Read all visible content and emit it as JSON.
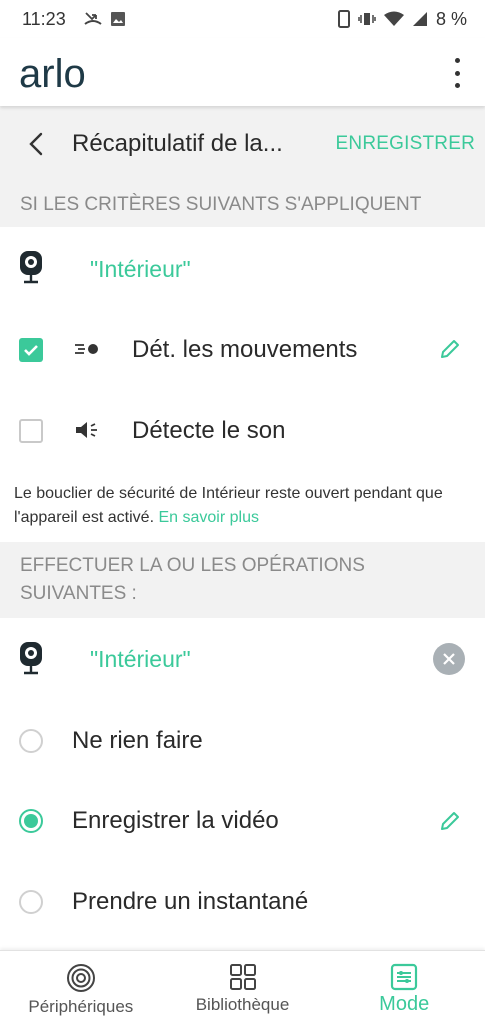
{
  "status_bar": {
    "time": "11:23",
    "battery": "8 %"
  },
  "app": {
    "logo": "arlo"
  },
  "title_bar": {
    "title": "Récapitulatif de la...",
    "save_label": "ENREGISTRER"
  },
  "trigger_section": {
    "header": "SI LES CRITÈRES SUIVANTS S'APPLIQUENT",
    "device_name": "\"Intérieur\"",
    "options": [
      {
        "label": "Dét. les mouvements",
        "checked": true
      },
      {
        "label": "Détecte le son",
        "checked": false
      }
    ],
    "info_text": "Le bouclier de sécurité de Intérieur reste ouvert pendant que l'appareil est activé.",
    "info_link": "En savoir plus"
  },
  "action_section": {
    "header_line1": "EFFECTUER LA OU LES OPÉRATIONS",
    "header_line2": "SUIVANTES :",
    "device_name": "\"Intérieur\"",
    "options": [
      {
        "label": "Ne rien faire",
        "selected": false
      },
      {
        "label": "Enregistrer la vidéo",
        "selected": true
      },
      {
        "label": "Prendre un instantané",
        "selected": false
      }
    ]
  },
  "bottom_nav": {
    "items": [
      {
        "label": "Périphériques",
        "icon": "devices-icon",
        "active": false
      },
      {
        "label": "Bibliothèque",
        "icon": "library-grid-icon",
        "active": false
      },
      {
        "label": "Mode",
        "icon": "mode-icon",
        "active": true
      }
    ]
  },
  "colors": {
    "accent": "#3bc99a",
    "section_bg": "#f2f2f2",
    "header_text": "#8a8a8a",
    "logo": "#1f3a47"
  }
}
